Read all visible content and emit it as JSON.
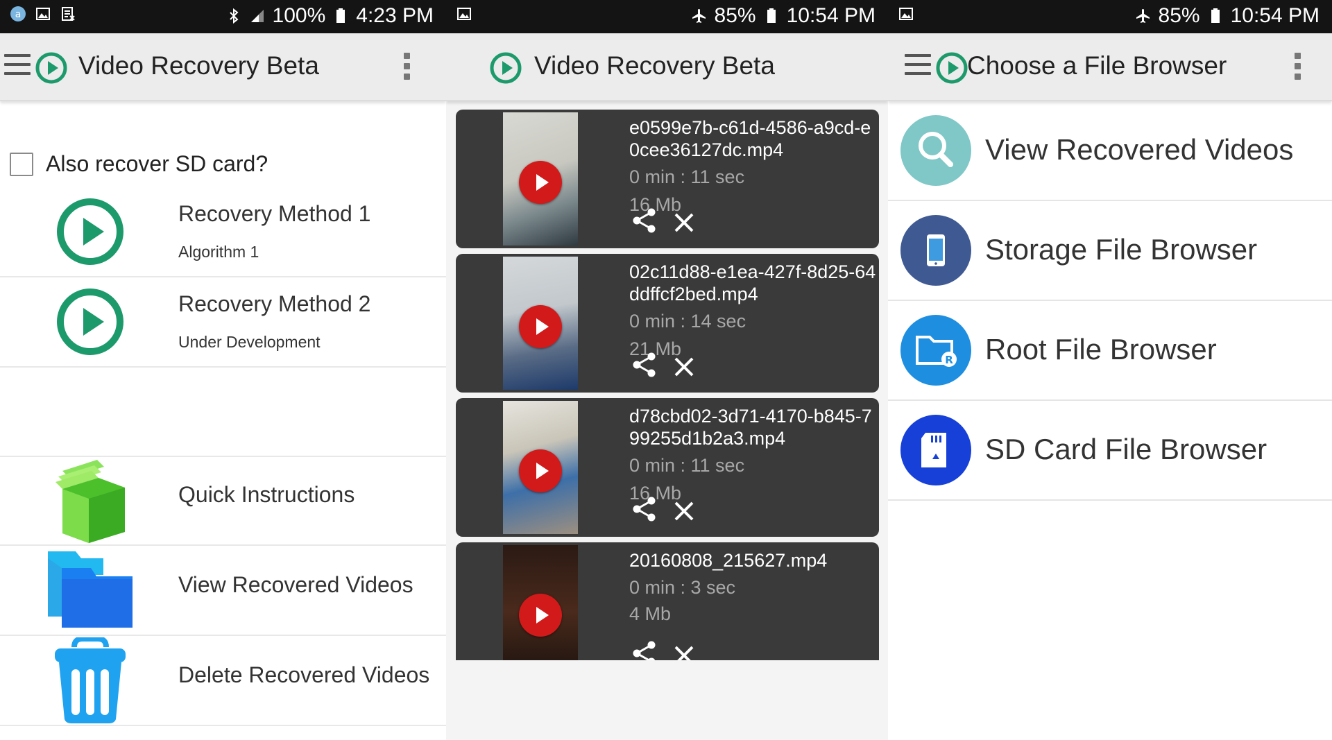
{
  "panel1": {
    "status": {
      "battery": "100%",
      "time": "4:23 PM"
    },
    "appbar": {
      "title": "Video Recovery Beta"
    },
    "sd_checkbox": {
      "label": "Also recover SD card?",
      "checked": false
    },
    "methods": [
      {
        "title": "Recovery Method 1",
        "subtitle": "Algorithm 1"
      },
      {
        "title": "Recovery Method 2",
        "subtitle": "Under Development"
      }
    ],
    "actions": [
      {
        "title": "Quick Instructions",
        "icon": "books-icon"
      },
      {
        "title": "View Recovered Videos",
        "icon": "folder-icon"
      },
      {
        "title": "Delete Recovered Videos",
        "icon": "trash-icon"
      }
    ]
  },
  "panel2": {
    "status": {
      "battery": "85%",
      "time": "10:54 PM"
    },
    "appbar": {
      "title": "Video Recovery Beta"
    },
    "videos": [
      {
        "filename": "e0599e7b-c61d-4586-a9cd-e0cee36127dc.mp4",
        "duration": "0 min : 11 sec",
        "size": "16 Mb"
      },
      {
        "filename": "02c11d88-e1ea-427f-8d25-64ddffcf2bed.mp4",
        "duration": "0 min : 14 sec",
        "size": "21 Mb"
      },
      {
        "filename": "d78cbd02-3d71-4170-b845-799255d1b2a3.mp4",
        "duration": "0 min : 11 sec",
        "size": "16 Mb"
      },
      {
        "filename": "20160808_215627.mp4",
        "duration": "0 min : 3 sec",
        "size": "4 Mb"
      }
    ]
  },
  "panel3": {
    "status": {
      "battery": "85%",
      "time": "10:54 PM"
    },
    "appbar": {
      "title": "Choose a File Browser"
    },
    "browsers": [
      {
        "label": "View Recovered Videos",
        "icon": "magnifier-icon",
        "color": "#7fc8c7"
      },
      {
        "label": "Storage File Browser",
        "icon": "phone-icon",
        "color": "#3f5a93"
      },
      {
        "label": "Root File Browser",
        "icon": "root-folder-icon",
        "color": "#1e8fe0"
      },
      {
        "label": "SD Card File Browser",
        "icon": "sd-card-icon",
        "color": "#1640d8"
      }
    ]
  },
  "colors": {
    "accent_green": "#1d9a6c",
    "play_red": "#d21a1a",
    "card_bg": "#3a3a3a"
  }
}
